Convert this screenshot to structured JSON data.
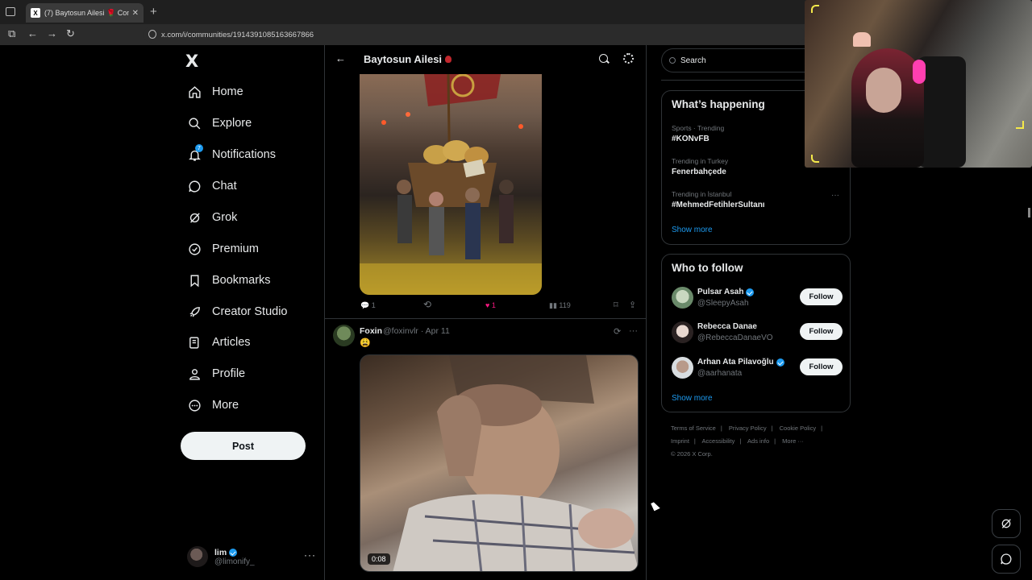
{
  "browser": {
    "tab_title": "(7) Baytosun Ailesi 🌹 Communi",
    "tab_close": "✕",
    "new_tab": "+",
    "url": "x.com/i/communities/1914391085163667866"
  },
  "sidebar": {
    "logo": "X",
    "items": [
      {
        "label": "Home",
        "icon": "home-icon"
      },
      {
        "label": "Explore",
        "icon": "search-icon"
      },
      {
        "label": "Notifications",
        "icon": "bell-icon",
        "badge": "7"
      },
      {
        "label": "Chat",
        "icon": "chat-icon"
      },
      {
        "label": "Grok",
        "icon": "grok-icon"
      },
      {
        "label": "Premium",
        "icon": "premium-icon"
      },
      {
        "label": "Bookmarks",
        "icon": "bookmark-icon"
      },
      {
        "label": "Creator Studio",
        "icon": "rocket-icon"
      },
      {
        "label": "Articles",
        "icon": "articles-icon"
      },
      {
        "label": "Profile",
        "icon": "person-icon"
      },
      {
        "label": "More",
        "icon": "more-icon"
      }
    ],
    "post_label": "Post",
    "account": {
      "name": "lim",
      "handle": "@limonify_",
      "more": "···"
    }
  },
  "main": {
    "title": "Baytosun Ailesi",
    "post1": {
      "replies": "1",
      "likes": "1",
      "views": "119"
    },
    "post2": {
      "name": "Foxin",
      "meta": "@foxinvlr · Apr 11",
      "emoji": "😩",
      "video_time": "0:08"
    }
  },
  "right": {
    "search_placeholder": "Search",
    "happening_title": "What’s happening",
    "trends": [
      {
        "context": "Sports · Trending",
        "topic": "#KONvFB"
      },
      {
        "context": "Trending in Turkey",
        "topic": "Fenerbahçede"
      },
      {
        "context": "Trending in İstanbul",
        "topic": "#MehmedFetihlerSultanı"
      }
    ],
    "trend_more": "···",
    "show_more": "Show more",
    "wtf_title": "Who to follow",
    "follow_label": "Follow",
    "suggestions": [
      {
        "name": "Pulsar Asah",
        "handle": "@SleepyAsah",
        "verified": true
      },
      {
        "name": "Rebecca Danae",
        "handle": "@RebeccaDanaeVO",
        "verified": false
      },
      {
        "name": "Arhan Ata Pilavoğlu",
        "handle": "@aarhanata",
        "verified": true
      }
    ],
    "footer": {
      "row1": [
        "Terms of Service",
        "|",
        "Privacy Policy",
        "|",
        "Cookie Policy",
        "|"
      ],
      "row2": [
        "Imprint",
        "|",
        "Accessibility",
        "|",
        "Ads info",
        "|",
        "More ···"
      ],
      "copyright": "© 2026 X Corp."
    }
  },
  "colors": {
    "accent": "#1d9bf0",
    "like": "#f91880",
    "background": "#000000",
    "border": "#2f3336",
    "muted": "#71767b"
  }
}
